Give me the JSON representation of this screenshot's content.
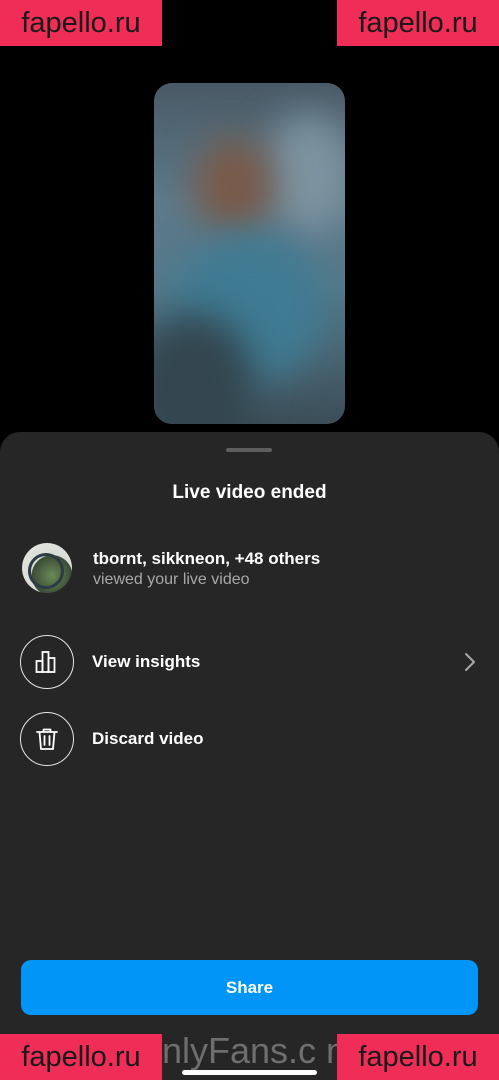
{
  "sheet": {
    "title": "Live video ended"
  },
  "viewers": {
    "names": "tbornt, sikkneon, +48 others",
    "subtitle": "viewed your live video"
  },
  "actions": [
    {
      "label": "View insights",
      "icon": "bar-chart-icon",
      "has_chevron": true
    },
    {
      "label": "Discard video",
      "icon": "trash-icon",
      "has_chevron": false
    }
  ],
  "share_button": {
    "label": "Share"
  },
  "watermarks": {
    "badge": "fapello.ru",
    "center": "OnlyFans.c m/"
  },
  "colors": {
    "sheet_background": "#262626",
    "share_blue": "#0095f6",
    "secondary_text": "#a8a8a8",
    "watermark_badge": "#ef2d56"
  }
}
